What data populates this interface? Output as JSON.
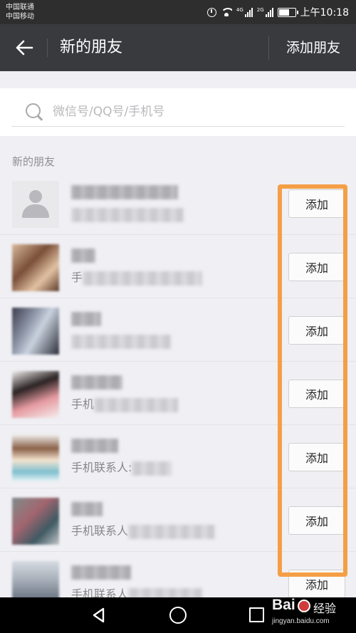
{
  "status_bar": {
    "carrier_1": "中国联通",
    "carrier_2": "中国移动",
    "net_1": "4G",
    "net_2": "2G",
    "time": "上午10:18",
    "battery_level": 0.7,
    "icons": [
      "alarm-icon",
      "wifi-icon",
      "signal-icon",
      "battery-icon"
    ]
  },
  "header": {
    "title": "新的朋友",
    "action_label": "添加朋友",
    "back_icon": "arrow-left-icon"
  },
  "search": {
    "placeholder": "微信号/QQ号/手机号",
    "value": ""
  },
  "section": {
    "label": "新的朋友"
  },
  "friends": [
    {
      "name": "",
      "subtitle_prefix": "",
      "button_label": "添加"
    },
    {
      "name": "",
      "subtitle_prefix": "手",
      "button_label": "添加"
    },
    {
      "name": "",
      "subtitle_prefix": "",
      "button_label": "添加"
    },
    {
      "name": "",
      "subtitle_prefix": "手机",
      "button_label": "添加"
    },
    {
      "name": "",
      "subtitle_prefix": "手机联系人:",
      "button_label": "添加"
    },
    {
      "name": "",
      "subtitle_prefix": "手机联系人",
      "button_label": "添加"
    },
    {
      "name": "",
      "subtitle_prefix": "手机联系人",
      "button_label": "添加"
    }
  ],
  "watermark": {
    "brand": "Bai",
    "jingyan": "经验",
    "url": "jingyan.baidu.com"
  },
  "colors": {
    "titlebar": "#393a3e",
    "statusbar": "#2e2e2e",
    "highlight": "#f49f45",
    "background": "#efeff4"
  }
}
